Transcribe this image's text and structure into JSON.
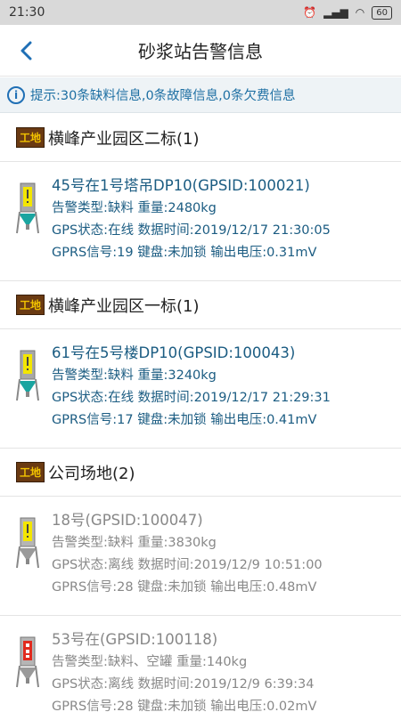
{
  "status_bar": {
    "time": "21:30",
    "battery": "60"
  },
  "header": {
    "title": "砂浆站告警信息"
  },
  "tip": {
    "text": "提示:30条缺料信息,0条故障信息,0条欠费信息"
  },
  "badge_text": "工地",
  "groups": [
    {
      "title": "横峰产业园区二标(1)",
      "items": [
        {
          "status": "online",
          "alert_level": "warning",
          "name": "45号在1号塔吊DP10(GPSID:100021)",
          "alert": "告警类型:缺料 重量:2480kg",
          "gps": "GPS状态:在线 数据时间:2019/12/17 21:30:05",
          "gprs": "GPRS信号:19 键盘:未加锁 输出电压:0.31mV"
        }
      ]
    },
    {
      "title": "横峰产业园区一标(1)",
      "items": [
        {
          "status": "online",
          "alert_level": "warning",
          "name": "61号在5号楼DP10(GPSID:100043)",
          "alert": "告警类型:缺料 重量:3240kg",
          "gps": "GPS状态:在线 数据时间:2019/12/17 21:29:31",
          "gprs": "GPRS信号:17 键盘:未加锁 输出电压:0.41mV"
        }
      ]
    },
    {
      "title": "公司场地(2)",
      "items": [
        {
          "status": "offline",
          "alert_level": "warning",
          "name": "18号(GPSID:100047)",
          "alert": "告警类型:缺料 重量:3830kg",
          "gps": "GPS状态:离线 数据时间:2019/12/9 10:51:00",
          "gprs": "GPRS信号:28 键盘:未加锁 输出电压:0.48mV"
        },
        {
          "status": "offline",
          "alert_level": "critical",
          "name": "53号在(GPSID:100118)",
          "alert": "告警类型:缺料、空罐 重量:140kg",
          "gps": "GPS状态:离线 数据时间:2019/12/9 6:39:34",
          "gprs": "GPRS信号:28 键盘:未加锁 输出电压:0.02mV"
        }
      ]
    }
  ],
  "colors": {
    "accent": "#1f6fb5",
    "online_text": "#1b5c82",
    "offline_text": "#888888",
    "badge_bg": "#6a3a12",
    "badge_text": "#f2c200",
    "teal": "#1aa5a0",
    "warning": "#f3e600",
    "critical": "#e12a1e"
  }
}
